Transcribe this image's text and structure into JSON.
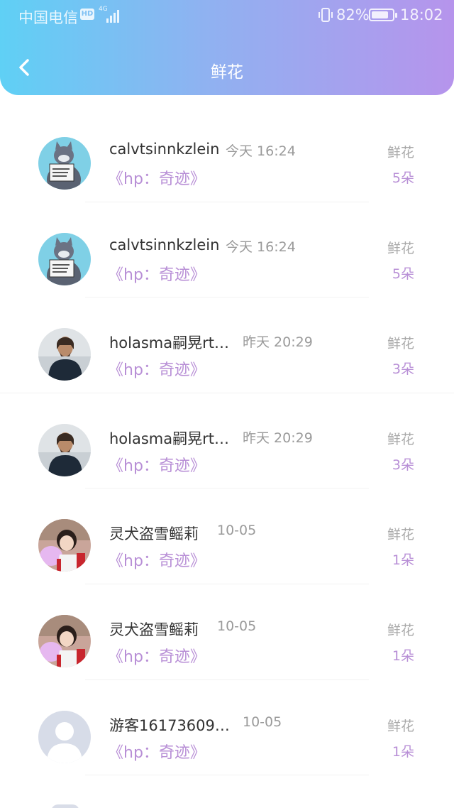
{
  "status_bar": {
    "carrier": "中国电信",
    "hd": "HD",
    "network": "4G",
    "battery": "82%",
    "battery_level": 0.82,
    "time": "18:02"
  },
  "header": {
    "title": "鲜花",
    "back_icon": "chevron-left-icon"
  },
  "colors": {
    "gradient_start": "#5fd0f5",
    "gradient_end": "#b694ec",
    "accent": "#b88fd6"
  },
  "items": [
    {
      "username": "calvtsinnkzlein",
      "time": "今天 16:24",
      "book": "《hp：奇迹》",
      "gift_label": "鲜花",
      "count": "5朵",
      "avatar": "cat-sign"
    },
    {
      "username": "calvtsinnkzlein",
      "time": "今天 16:24",
      "book": "《hp：奇迹》",
      "gift_label": "鲜花",
      "count": "5朵",
      "avatar": "cat-sign"
    },
    {
      "username": "holasma嗣晃rt…",
      "time": "昨天 20:29",
      "book": "《hp：奇迹》",
      "gift_label": "鲜花",
      "count": "3朵",
      "avatar": "hooded-man"
    },
    {
      "username": "holasma嗣晃rt…",
      "time": "昨天 20:29",
      "book": "《hp：奇迹》",
      "gift_label": "鲜花",
      "count": "3朵",
      "avatar": "hooded-man"
    },
    {
      "username": "灵犬盗雪鳐莉",
      "time": "10-05",
      "book": "《hp：奇迹》",
      "gift_label": "鲜花",
      "count": "1朵",
      "avatar": "girl-cotton-candy"
    },
    {
      "username": "灵犬盗雪鳐莉",
      "time": "10-05",
      "book": "《hp：奇迹》",
      "gift_label": "鲜花",
      "count": "1朵",
      "avatar": "girl-cotton-candy"
    },
    {
      "username": "游客16173609…",
      "time": "10-05",
      "book": "《hp：奇迹》",
      "gift_label": "鲜花",
      "count": "1朵",
      "avatar": "default-user"
    }
  ]
}
